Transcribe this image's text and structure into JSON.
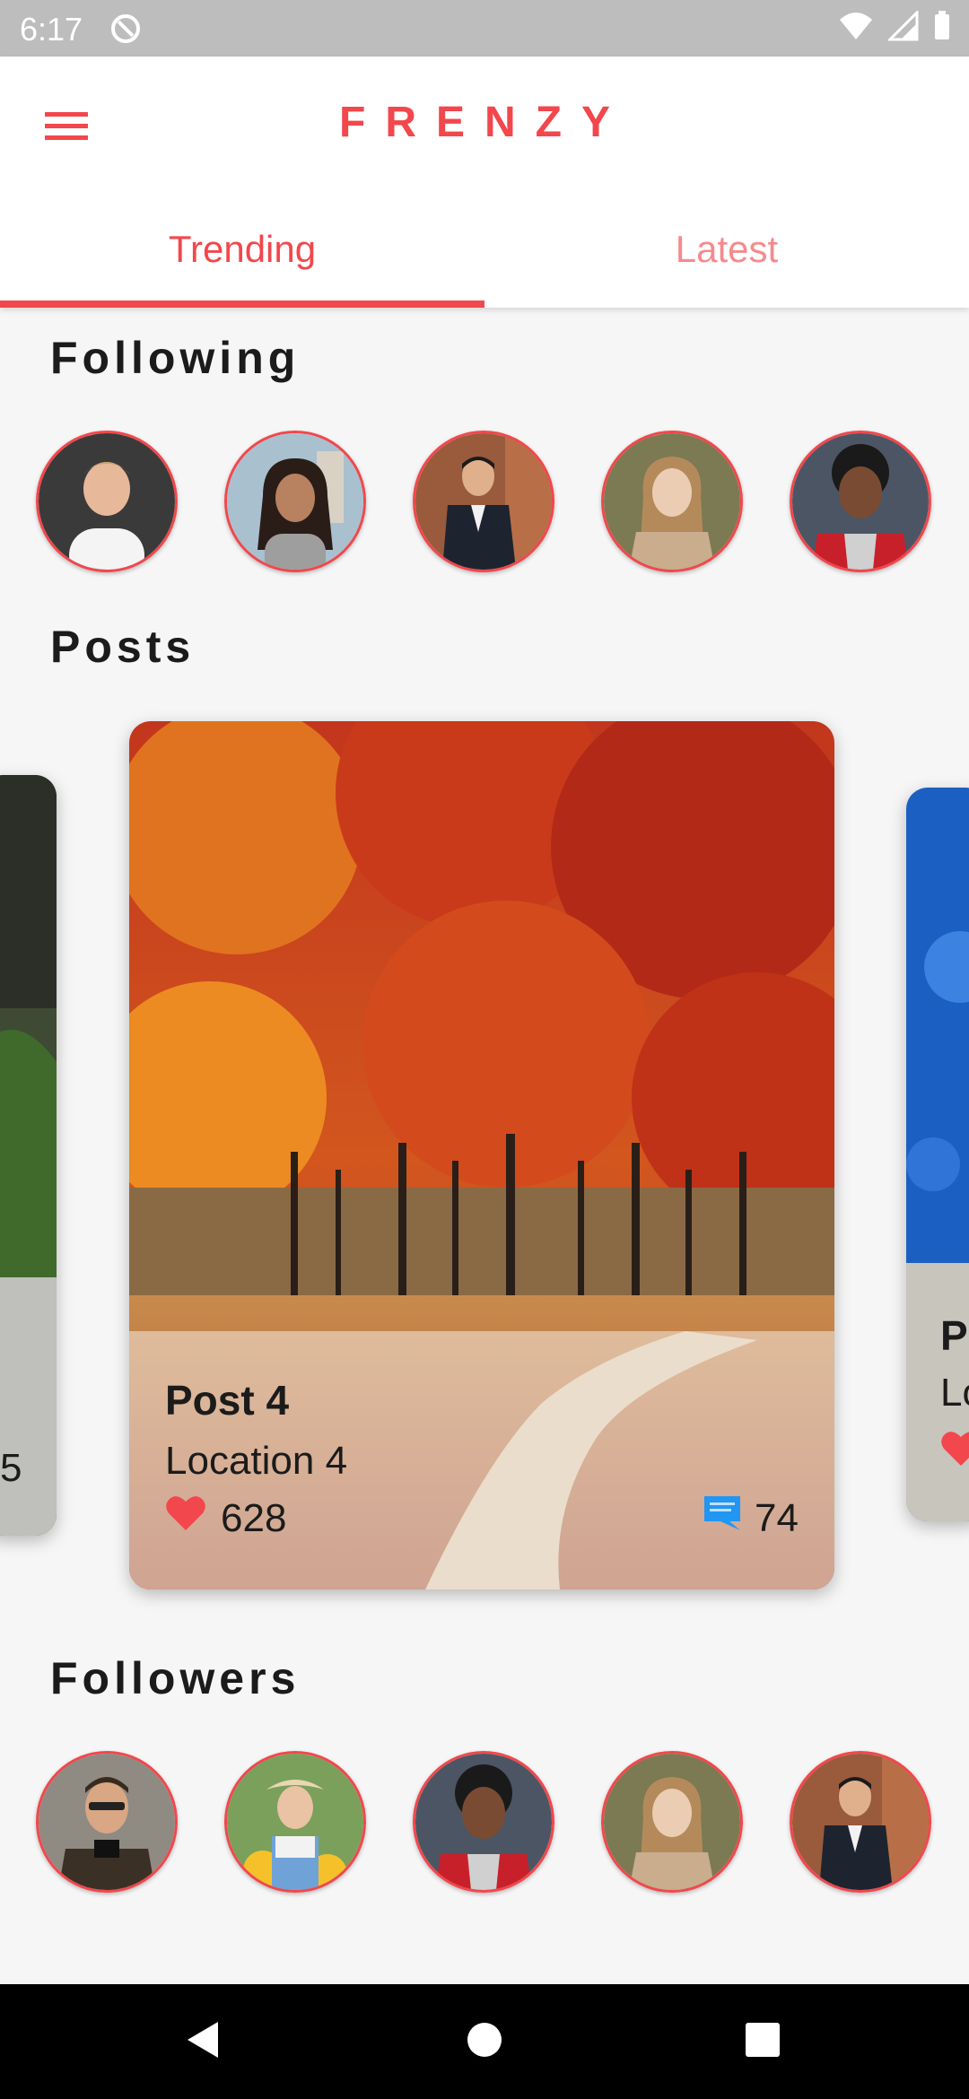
{
  "status_bar": {
    "time": "6:17"
  },
  "app": {
    "title": "FRENZY"
  },
  "tabs": [
    {
      "label": "Trending"
    },
    {
      "label": "Latest"
    }
  ],
  "sections": {
    "following": "Following",
    "posts": "Posts",
    "followers": "Followers"
  },
  "following": [
    {
      "name": "person-1"
    },
    {
      "name": "person-2"
    },
    {
      "name": "person-3"
    },
    {
      "name": "person-4"
    },
    {
      "name": "person-5"
    }
  ],
  "posts": {
    "left_peek": {
      "likes_fragment": "5"
    },
    "main": {
      "title": "Post 4",
      "location": "Location 4",
      "likes": "628",
      "comments": "74"
    },
    "right_peek": {
      "title_fragment": "P",
      "location_fragment": "Lo"
    }
  },
  "followers": [
    {
      "name": "person-6"
    },
    {
      "name": "person-7"
    },
    {
      "name": "person-5"
    },
    {
      "name": "person-4"
    },
    {
      "name": "person-3"
    }
  ],
  "colors": {
    "accent": "#f2474c",
    "accent_light": "#f58a8e",
    "comment": "#2196f3"
  }
}
